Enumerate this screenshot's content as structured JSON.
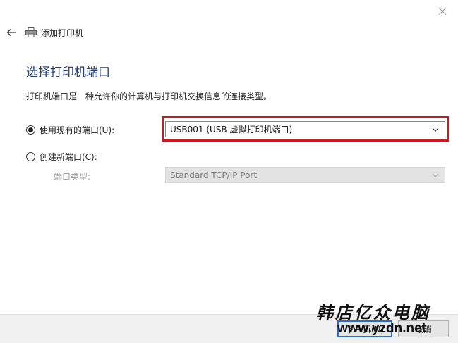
{
  "header": {
    "title": "添加打印机",
    "back_icon": "back-arrow-icon",
    "printer_icon": "printer-icon",
    "close_icon": "close-icon"
  },
  "page": {
    "title": "选择打印机端口",
    "description": "打印机端口是一种允许你的计算机与打印机交换信息的连接类型。"
  },
  "options": {
    "use_existing": {
      "label": "使用现有的端口(U):",
      "selected": true,
      "value": "USB001 (USB 虚拟打印机端口)"
    },
    "create_new": {
      "label": "创建新端口(C):",
      "selected": false,
      "port_type_label": "端口类型:",
      "value": "Standard TCP/IP Port"
    }
  },
  "footer": {
    "next_label": "下一页(N)",
    "cancel_label": "取消"
  },
  "watermark": {
    "chinese": "韩店亿众电脑",
    "url": "www.yzdn.net"
  },
  "colors": {
    "title": "#1f3d8a",
    "highlight": "#d7141a",
    "focus": "#2a6ad8"
  }
}
